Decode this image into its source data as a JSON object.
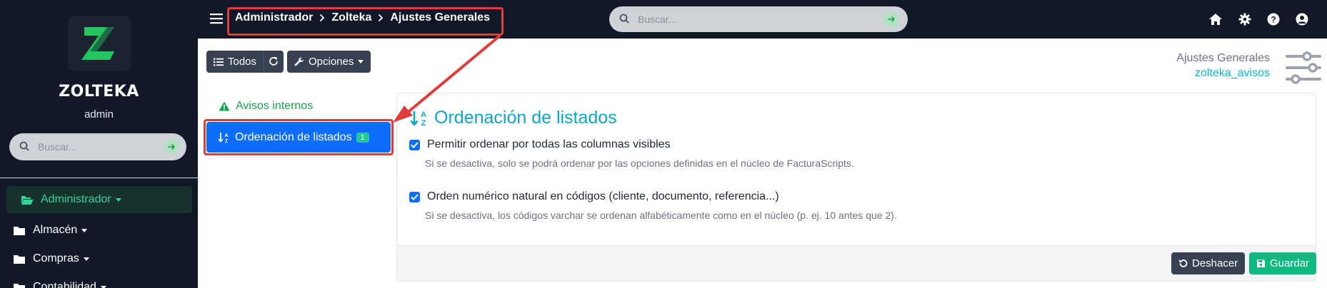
{
  "brand": {
    "name": "ZOLTEKA",
    "user": "admin",
    "logo_letter": "Z"
  },
  "sidebar": {
    "search_placeholder": "Buscar...",
    "items": [
      {
        "label": "Administrador",
        "active": true,
        "icon": "folder-open-icon"
      },
      {
        "label": "Almacén",
        "active": false,
        "icon": "folder-icon"
      },
      {
        "label": "Compras",
        "active": false,
        "icon": "folder-icon"
      },
      {
        "label": "Contabilidad",
        "active": false,
        "icon": "folder-icon"
      }
    ]
  },
  "topbar": {
    "breadcrumb": [
      "Administrador",
      "Zolteka",
      "Ajustes Generales"
    ],
    "search_placeholder": "Buscar...",
    "icons": [
      "home-icon",
      "gear-icon",
      "help-icon",
      "user-icon"
    ]
  },
  "toolbar": {
    "all_label": "Todos",
    "options_label": "Opciones"
  },
  "page": {
    "title": "Ajustes Generales",
    "subtitle": "zolteka_avisos"
  },
  "tabs": [
    {
      "label": "Avisos internos",
      "icon": "warning-icon"
    },
    {
      "label": "Ordenación de listados",
      "badge": "1",
      "icon": "sort-icon",
      "active": true
    }
  ],
  "card": {
    "title": "Ordenación de listados",
    "options": [
      {
        "label": "Permitir ordenar por todas las columnas visibles",
        "checked": true,
        "help": "Si se desactiva, solo se podrá ordenar por las opciones definidas en el núcleo de FacturaScripts."
      },
      {
        "label": "Orden numérico natural en códigos (cliente, documento, referencia...)",
        "checked": true,
        "help": "Si se desactiva, los códigos varchar se ordenan alfabéticamente como en el núcleo (p. ej. 10 antes que 2)."
      }
    ],
    "undo_label": "Deshacer",
    "save_label": "Guardar"
  },
  "colors": {
    "sidebar_bg": "#111827",
    "accent": "#0d6efd",
    "success": "#10b981",
    "cyan": "#06b6d4",
    "annotation": "#e03c3c"
  }
}
